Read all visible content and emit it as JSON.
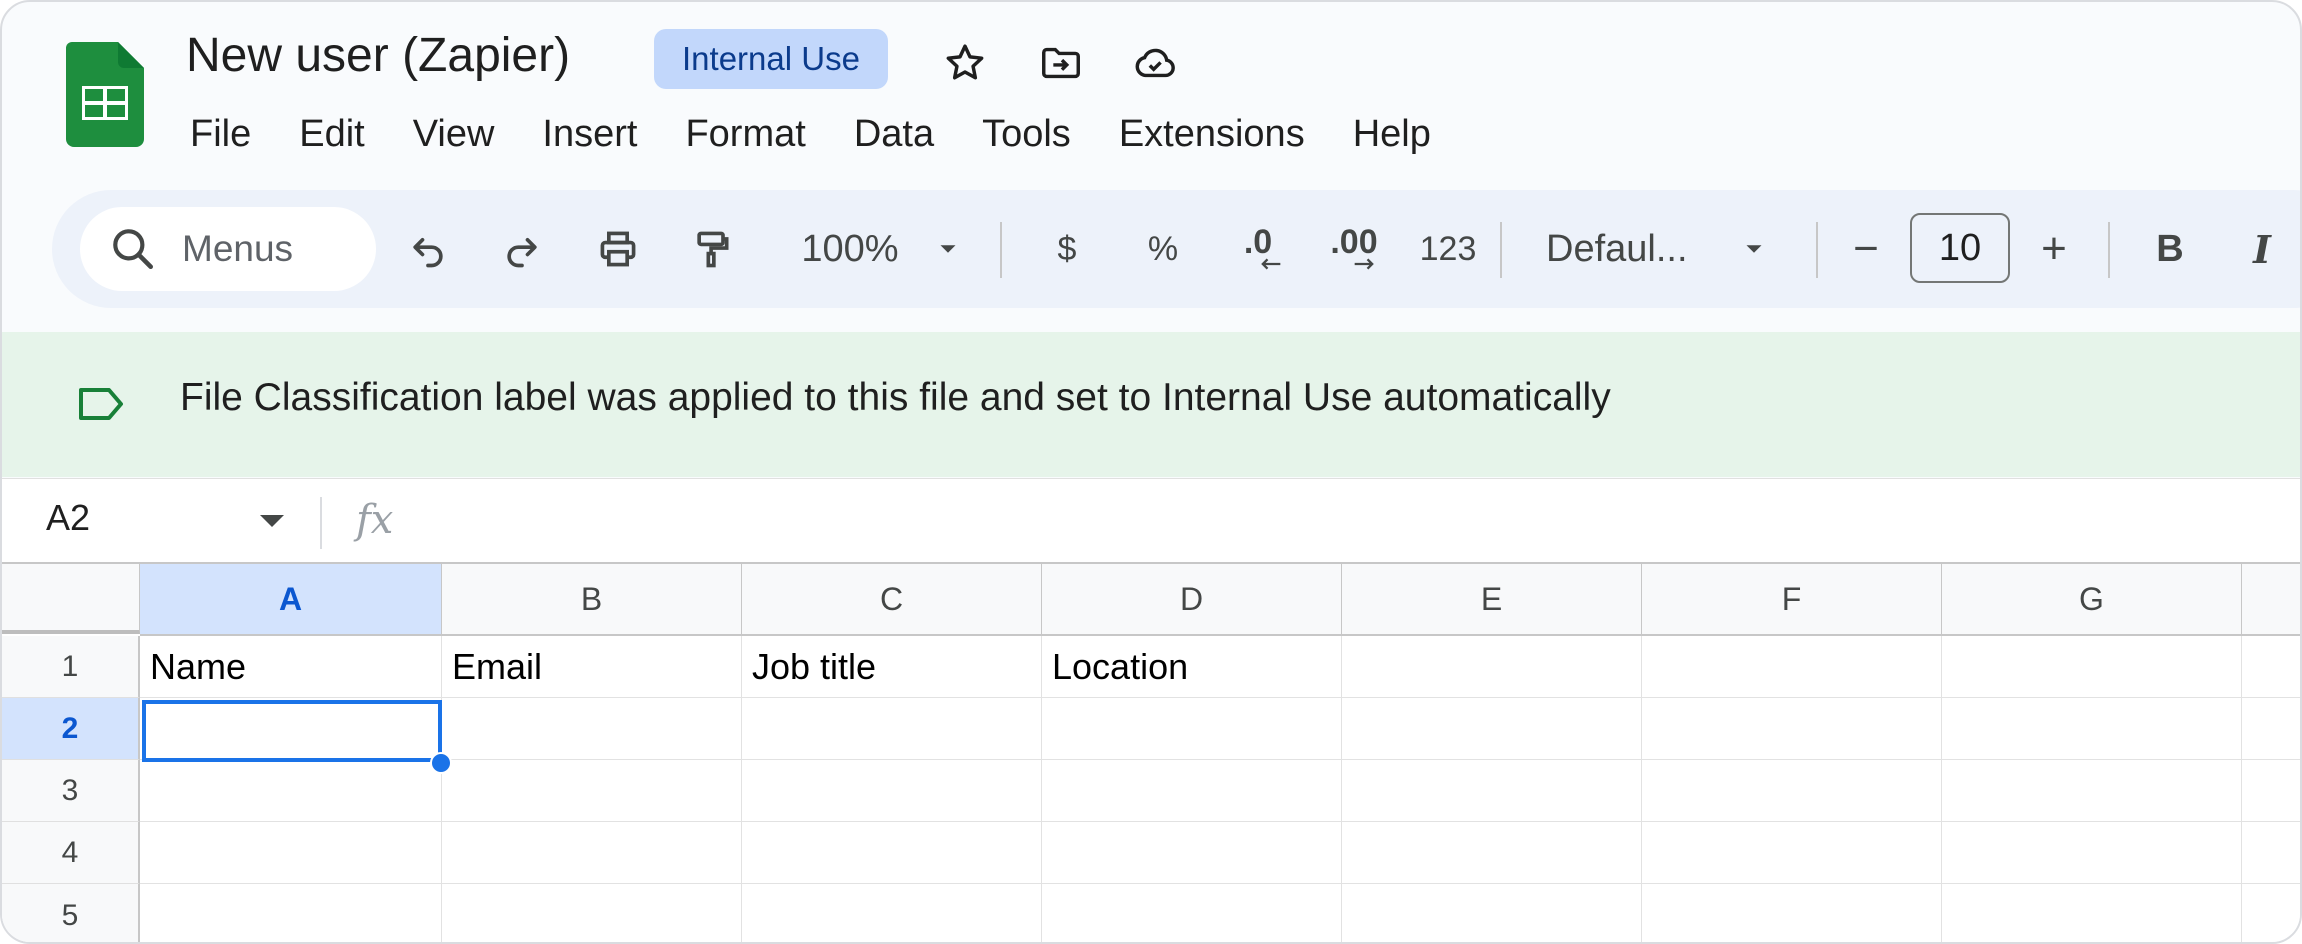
{
  "document": {
    "title": "New user (Zapier)",
    "badge": "Internal Use"
  },
  "menu": [
    "File",
    "Edit",
    "View",
    "Insert",
    "Format",
    "Data",
    "Tools",
    "Extensions",
    "Help"
  ],
  "toolbar": {
    "search_label": "Menus",
    "zoom": "100%",
    "currency": "$",
    "percent": "%",
    "decrease_decimal": ".0",
    "increase_decimal": ".00",
    "number_format": "123",
    "font": "Defaul...",
    "decrease_size": "−",
    "font_size": "10",
    "increase_size": "+",
    "bold": "B",
    "italic": "I"
  },
  "banner": {
    "text": "File Classification label was applied to this file and set to Internal Use automatically"
  },
  "formula_bar": {
    "cell_ref": "A2",
    "fx": "fx",
    "value": ""
  },
  "sheet": {
    "columns": [
      "A",
      "B",
      "C",
      "D",
      "E",
      "F",
      "G"
    ],
    "rows": [
      "1",
      "2",
      "3",
      "4",
      "5"
    ],
    "selected_column": "A",
    "selected_row": "2",
    "header_row": [
      "Name",
      "Email",
      "Job title",
      "Location"
    ]
  },
  "colors": {
    "accent": "#1a73e8",
    "badge_bg": "#c2d7fb",
    "banner_bg": "#e6f4ea",
    "banner_icon": "#188038",
    "sheets_green": "#1e8e3e"
  }
}
